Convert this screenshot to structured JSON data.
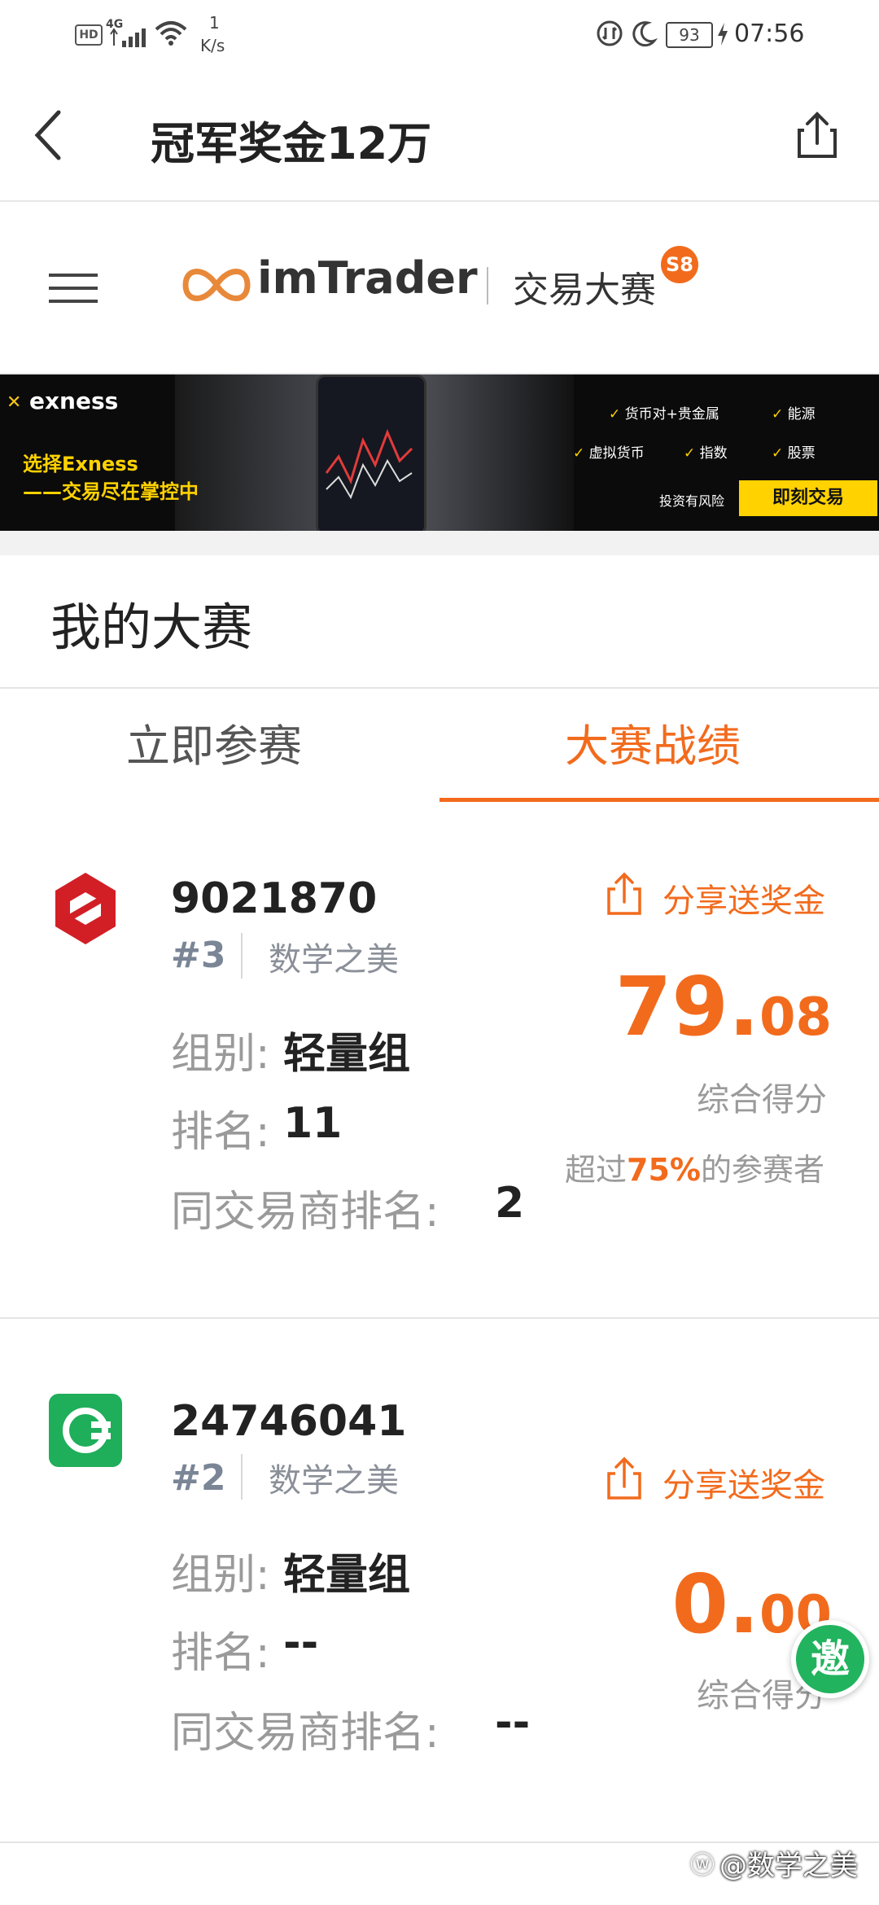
{
  "status_bar": {
    "network": "4G",
    "speed_value": "1",
    "speed_unit": "K/s",
    "battery": "93",
    "time": "07:56"
  },
  "header": {
    "title": "冠军奖金12万"
  },
  "brand": {
    "logo_text": "imTrader",
    "subtitle": "交易大赛",
    "season_badge": "S8"
  },
  "banner": {
    "brand": "exness",
    "line1": "选择Exness",
    "line2": "——交易尽在掌控中",
    "features": [
      "货币对+贵金属",
      "能源",
      "虚拟货币",
      "指数",
      "股票"
    ],
    "risk": "投资有风险",
    "cta": "即刻交易"
  },
  "section": {
    "title": "我的大赛"
  },
  "tabs": [
    {
      "label": "立即参赛",
      "active": false
    },
    {
      "label": "大赛战绩",
      "active": true
    }
  ],
  "labels": {
    "group": "组别:",
    "rank": "排名:",
    "broker_rank": "同交易商排名:",
    "share": "分享送奖金",
    "score_label": "综合得分"
  },
  "cards": [
    {
      "account": "9021870",
      "badge": "#3",
      "user": "数学之美",
      "group": "轻量组",
      "rank": "11",
      "broker_rank": "2",
      "score_int": "79.",
      "score_dec": "08",
      "beat_prefix": "超过",
      "beat_pct": "75%",
      "beat_suffix": "的参赛者",
      "logo_color": "#d21f26"
    },
    {
      "account": "24746041",
      "badge": "#2",
      "user": "数学之美",
      "group": "轻量组",
      "rank": "--",
      "broker_rank": "--",
      "score_int": "0.",
      "score_dec": "00",
      "logo_color": "#1fae5a"
    }
  ],
  "floating": {
    "invite": "邀"
  },
  "watermark": "@数学之美",
  "colors": {
    "accent": "#f26b1d",
    "banner_cta": "#ffd200",
    "invite_green": "#22b35e"
  }
}
